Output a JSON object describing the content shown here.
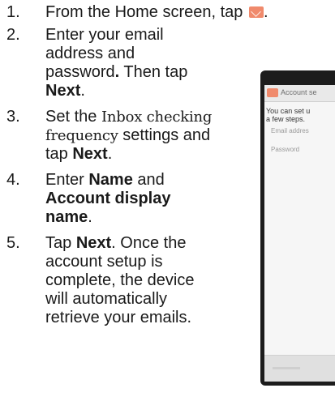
{
  "steps": [
    {
      "number": "1.",
      "lines": [
        [
          {
            "text": "From the Home screen, tap "
          },
          {
            "icon": "email-icon"
          },
          {
            "text": "."
          }
        ]
      ]
    },
    {
      "number": "2.",
      "lines": [
        [
          {
            "text": "Enter your email"
          }
        ],
        [
          {
            "text": "address and"
          }
        ],
        [
          {
            "text": "password"
          },
          {
            "text": ".",
            "bold": true
          },
          {
            "text": " Then tap"
          }
        ],
        [
          {
            "text": "Next",
            "bold": true
          },
          {
            "text": "."
          }
        ]
      ]
    },
    {
      "number": "3.",
      "lines": [
        [
          {
            "text": "Set the "
          },
          {
            "text": "Inbox checking",
            "serif": true
          }
        ],
        [
          {
            "text": "frequency",
            "serif": true
          },
          {
            "text": " settings and"
          }
        ],
        [
          {
            "text": "tap "
          },
          {
            "text": "Next",
            "bold": true
          },
          {
            "text": "."
          }
        ]
      ]
    },
    {
      "number": "4.",
      "lines": [
        [
          {
            "text": "Enter "
          },
          {
            "text": "Name",
            "bold": true
          },
          {
            "text": " and"
          }
        ],
        [
          {
            "text": "Account display",
            "bold": true
          }
        ],
        [
          {
            "text": "name",
            "bold": true
          },
          {
            "text": "."
          }
        ]
      ]
    },
    {
      "number": "5.",
      "lines": [
        [
          {
            "text": "Tap "
          },
          {
            "text": "Next",
            "bold": true
          },
          {
            "text": ". Once the"
          }
        ],
        [
          {
            "text": "account setup is"
          }
        ],
        [
          {
            "text": "complete, the device"
          }
        ],
        [
          {
            "text": "will automatically"
          }
        ],
        [
          {
            "text": "retrieve your emails."
          }
        ]
      ]
    }
  ],
  "phone": {
    "title": "Account se",
    "intro_line1": "You can set u",
    "intro_line2": "a few steps.",
    "email_label": "Email addres",
    "password_label": "Password"
  },
  "colors": {
    "email_icon": "#f08a6c",
    "text": "#1a1a1a"
  }
}
